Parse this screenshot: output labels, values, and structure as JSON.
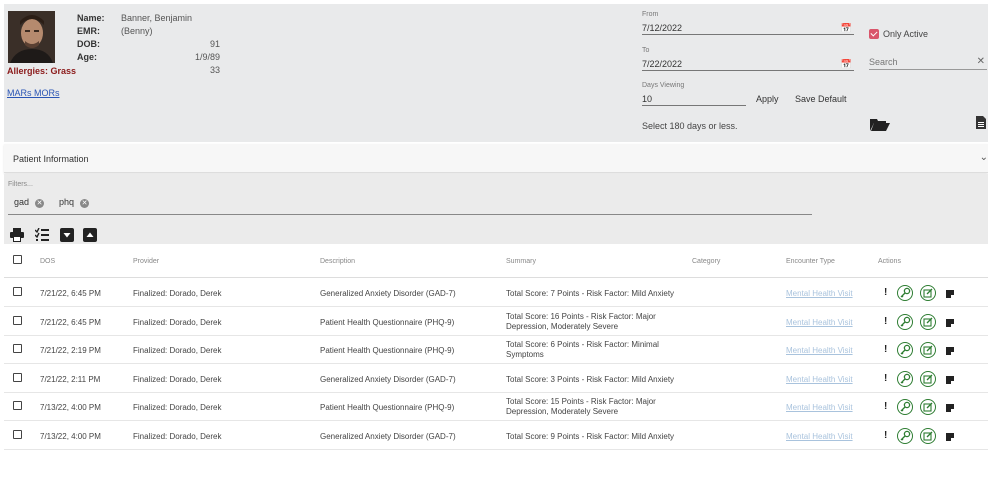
{
  "patient": {
    "labels": {
      "name": "Name:",
      "emr": "EMR:",
      "dob": "DOB:",
      "age": "Age:"
    },
    "name": "Banner, Benjamin (Benny)",
    "emr": "91",
    "dob": "1/9/89",
    "age": "33",
    "allergies": "Allergies: Grass",
    "mars_link": "MARs MORs"
  },
  "date_filter": {
    "from_label": "From",
    "from_value": "7/12/2022",
    "to_label": "To",
    "to_value": "7/22/2022",
    "days_label": "Days Viewing",
    "days_value": "10",
    "apply_label": "Apply",
    "save_default_label": "Save Default",
    "hint": "Select 180 days or less."
  },
  "only_active": {
    "label": "Only Active",
    "checked": true,
    "color": "#d9556b"
  },
  "search": {
    "placeholder": "Search"
  },
  "patient_info_bar": {
    "label": "Patient Information"
  },
  "filters": {
    "label": "Filters...",
    "chips": [
      "gad",
      "phq"
    ]
  },
  "table": {
    "columns": {
      "dos": "DOS",
      "provider": "Provider",
      "description": "Description",
      "summary": "Summary",
      "category": "Category",
      "encounter_type": "Encounter Type",
      "actions": "Actions"
    },
    "rows": [
      {
        "dos": "7/21/22, 6:45 PM",
        "provider": "Finalized: Dorado, Derek",
        "description": "Generalized Anxiety Disorder (GAD-7)",
        "summary1": "Total Score: 7 Points - Risk Factor: Mild Anxiety",
        "summary2": "",
        "category": "",
        "encounter_type": "Mental Health Visit"
      },
      {
        "dos": "7/21/22, 6:45 PM",
        "provider": "Finalized: Dorado, Derek",
        "description": "Patient Health Questionnaire (PHQ-9)",
        "summary1": "Total Score: 16 Points - Risk Factor: Major",
        "summary2": "Depression, Moderately Severe",
        "category": "",
        "encounter_type": "Mental Health Visit"
      },
      {
        "dos": "7/21/22, 2:19 PM",
        "provider": "Finalized: Dorado, Derek",
        "description": "Patient Health Questionnaire (PHQ-9)",
        "summary1": "Total Score: 6 Points - Risk Factor: Minimal",
        "summary2": "Symptoms",
        "category": "",
        "encounter_type": "Mental Health Visit"
      },
      {
        "dos": "7/21/22, 2:11 PM",
        "provider": "Finalized: Dorado, Derek",
        "description": "Generalized Anxiety Disorder (GAD-7)",
        "summary1": "Total Score: 3 Points - Risk Factor: Mild Anxiety",
        "summary2": "",
        "category": "",
        "encounter_type": "Mental Health Visit"
      },
      {
        "dos": "7/13/22, 4:00 PM",
        "provider": "Finalized: Dorado, Derek",
        "description": "Patient Health Questionnaire (PHQ-9)",
        "summary1": "Total Score: 15 Points - Risk Factor: Major",
        "summary2": "Depression, Moderately Severe",
        "category": "",
        "encounter_type": "Mental Health Visit"
      },
      {
        "dos": "7/13/22, 4:00 PM",
        "provider": "Finalized: Dorado, Derek",
        "description": "Generalized Anxiety Disorder (GAD-7)",
        "summary1": "Total Score: 9 Points - Risk Factor: Mild Anxiety",
        "summary2": "",
        "category": "",
        "encounter_type": "Mental Health Visit"
      }
    ],
    "row_actions": [
      "exclamation-icon",
      "key-icon",
      "edit-icon",
      "note-icon"
    ]
  },
  "toolbar_icons": [
    "print-icon",
    "checklist-icon",
    "collapse-down-icon",
    "collapse-up-icon"
  ],
  "colors": {
    "allergy": "#8b1a1a",
    "link": "#2a55b5",
    "action_green": "#2e7d32",
    "encounter_link": "#a9c3dd"
  }
}
